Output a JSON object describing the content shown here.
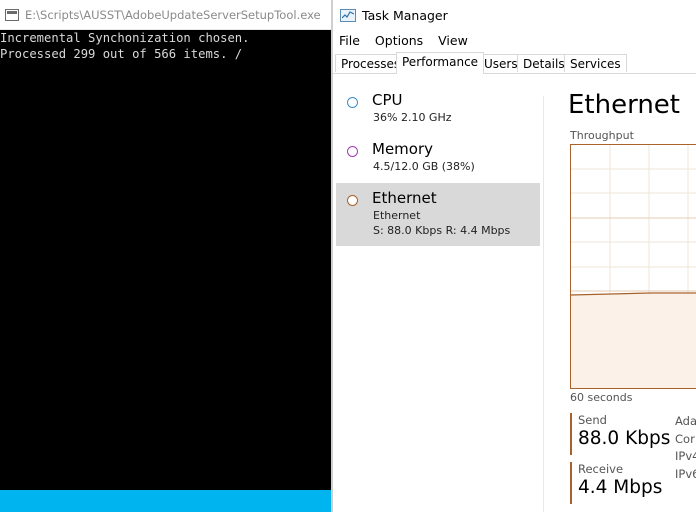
{
  "console": {
    "title": "E:\\Scripts\\AUSST\\AdobeUpdateServerSetupTool.exe",
    "lines": [
      "Incremental Synchonization chosen.",
      "Processed 299 out of 566 items. /"
    ]
  },
  "taskmanager": {
    "title": "Task Manager",
    "menu": [
      "File",
      "Options",
      "View"
    ],
    "tabs": [
      "Processes",
      "Performance",
      "Users",
      "Details",
      "Services"
    ],
    "active_tab": "Performance",
    "resources": [
      {
        "name": "CPU",
        "detail": "36%  2.10 GHz",
        "color": "#3d8fc6"
      },
      {
        "name": "Memory",
        "detail": "4.5/12.0 GB (38%)",
        "color": "#a23bb0"
      },
      {
        "name": "Ethernet",
        "sub": "Ethernet",
        "detail": "S: 88.0 Kbps  R: 4.4 Mbps",
        "color": "#a8622a",
        "selected": true
      }
    ],
    "pane": {
      "title": "Ethernet",
      "graph_label": "Throughput",
      "time_label": "60 seconds",
      "send_label": "Send",
      "send_value": "88.0 Kbps",
      "receive_label": "Receive",
      "receive_value": "4.4 Mbps",
      "info_fragments": [
        "Ada",
        "Cor",
        "IPv4",
        "IPv6"
      ]
    }
  }
}
